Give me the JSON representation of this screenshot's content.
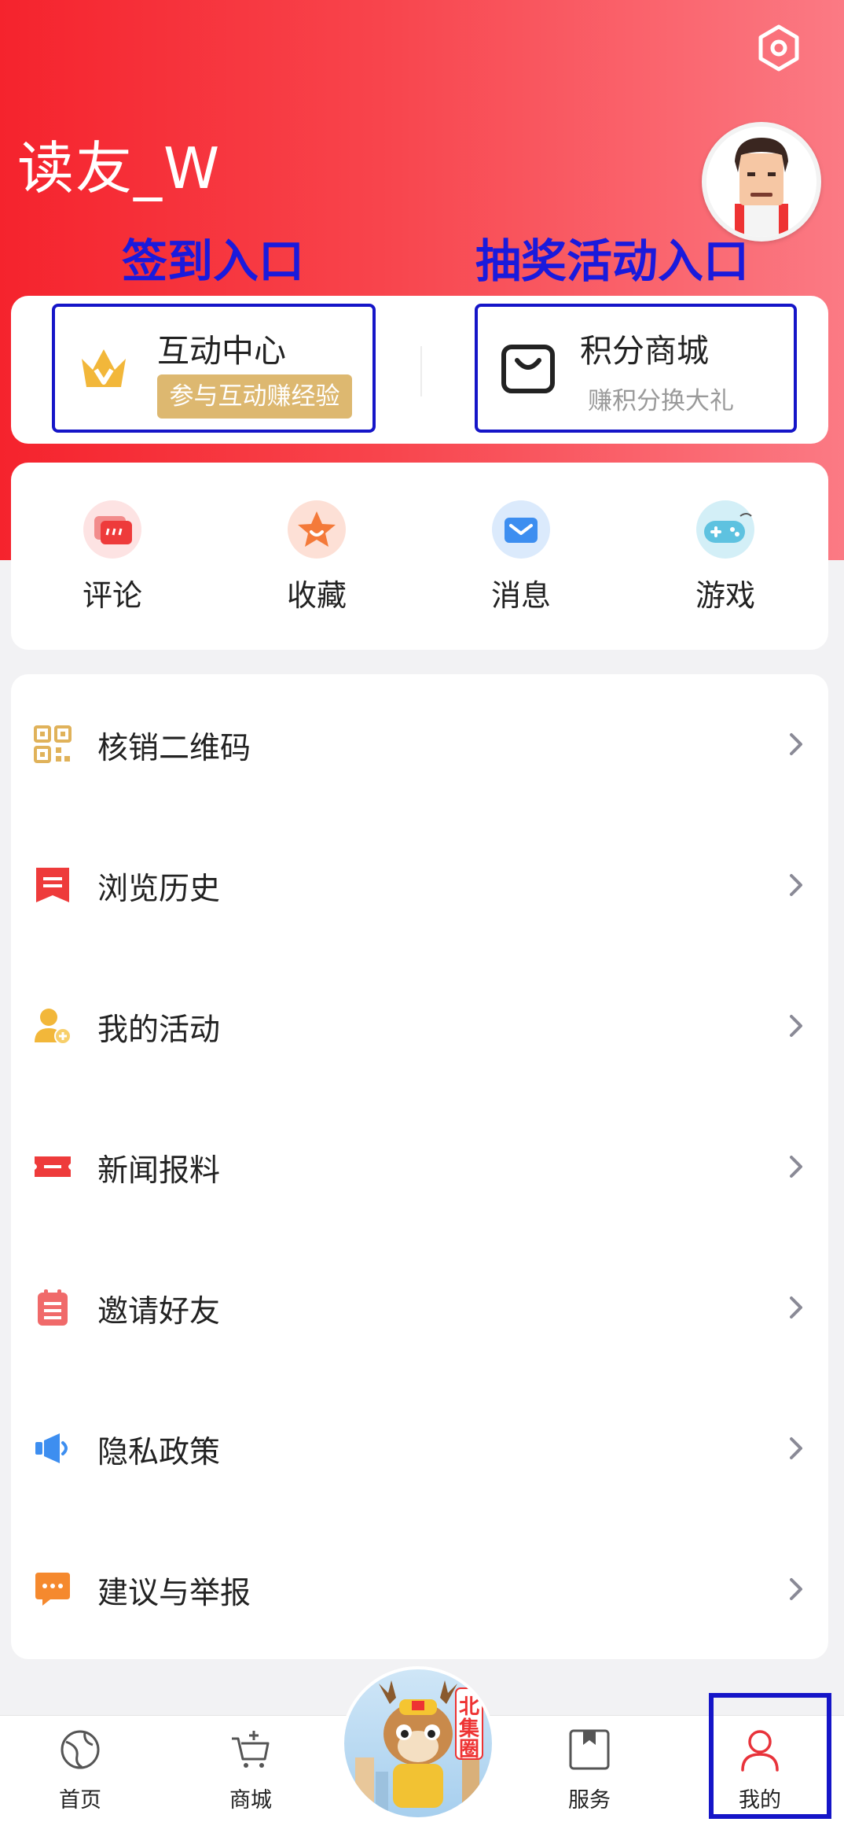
{
  "header": {
    "username": "读友_W",
    "annotation_left": "签到入口",
    "annotation_right": "抽奖活动入口"
  },
  "promo": {
    "interaction": {
      "title": "互动中心",
      "badge": "参与互动赚经验"
    },
    "points_mall": {
      "title": "积分商城",
      "subtitle": "赚积分换大礼"
    }
  },
  "shortcuts": [
    {
      "label": "评论"
    },
    {
      "label": "收藏"
    },
    {
      "label": "消息"
    },
    {
      "label": "游戏"
    }
  ],
  "menu": [
    {
      "label": "核销二维码"
    },
    {
      "label": "浏览历史"
    },
    {
      "label": "我的活动"
    },
    {
      "label": "新闻报料"
    },
    {
      "label": "邀请好友"
    },
    {
      "label": "隐私政策"
    },
    {
      "label": "建议与举报"
    }
  ],
  "tabbar": {
    "home": "首页",
    "mall": "商城",
    "service": "服务",
    "mine": "我的",
    "mascot_text": "北集圈"
  },
  "colors": {
    "brand_red": "#f5232d",
    "annotation_blue": "#1515c8",
    "badge_gold": "#ddb870"
  }
}
